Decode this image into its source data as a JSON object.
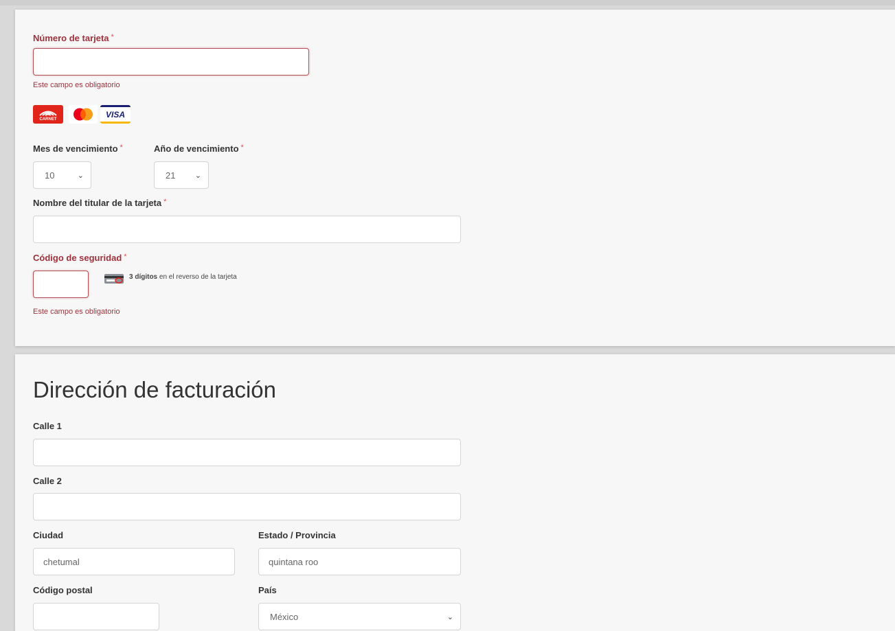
{
  "payment": {
    "card_number": {
      "label": "Número de tarjeta",
      "required": "*",
      "value": "",
      "error": "Este campo es obligatorio"
    },
    "card_brands": [
      "Carnet",
      "Mastercard",
      "Visa"
    ],
    "carnet_text": "CARNET",
    "visa_text": "VISA",
    "exp_month": {
      "label": "Mes de vencimiento",
      "required": "*",
      "value": "10"
    },
    "exp_year": {
      "label": "Año de vencimiento",
      "required": "*",
      "value": "21"
    },
    "holder_name": {
      "label": "Nombre del titular de la tarjeta",
      "required": "*",
      "value": ""
    },
    "security_code": {
      "label": "Código de seguridad",
      "required": "*",
      "value": "",
      "hint_bold": "3 dígitos",
      "hint_rest": "en el reverso de la tarjeta",
      "error": "Este campo es obligatorio"
    }
  },
  "billing": {
    "title": "Dirección de facturación",
    "street1": {
      "label": "Calle 1",
      "value": ""
    },
    "street2": {
      "label": "Calle 2",
      "value": ""
    },
    "city": {
      "label": "Ciudad",
      "value": "chetumal"
    },
    "state": {
      "label": "Estado / Provincia",
      "value": "quintana roo"
    },
    "postal_code": {
      "label": "Código postal",
      "value": ""
    },
    "country": {
      "label": "País",
      "value": "México"
    }
  },
  "colors": {
    "error": "#a0313b",
    "required": "#d9534f",
    "panel": "#f7f7f7"
  }
}
